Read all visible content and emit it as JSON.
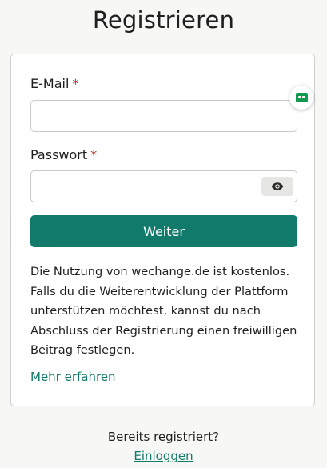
{
  "page": {
    "title": "Registrieren"
  },
  "form": {
    "email_label": "E-Mail",
    "email_required_mark": "*",
    "email_value": "",
    "password_label": "Passwort",
    "password_required_mark": "*",
    "password_value": "",
    "show_password_icon": "eye-icon",
    "submit_label": "Weiter",
    "info_text": "Die Nutzung von wechange.de ist kostenlos. Falls du die Weiterentwicklung der Plattform unterstützen möchtest, kannst du nach Abschluss der Registrierung einen freiwilligen Beitrag festlegen.",
    "learn_more_label": "Mehr erfahren"
  },
  "footer": {
    "already_registered": "Bereits registriert?",
    "login_label": "Einloggen"
  },
  "extension_badge": {
    "icon": "password-manager-icon"
  },
  "colors": {
    "accent": "#127a6a",
    "required": "#b3261e",
    "background": "#f7f7f5",
    "badge": "#129a4e"
  }
}
